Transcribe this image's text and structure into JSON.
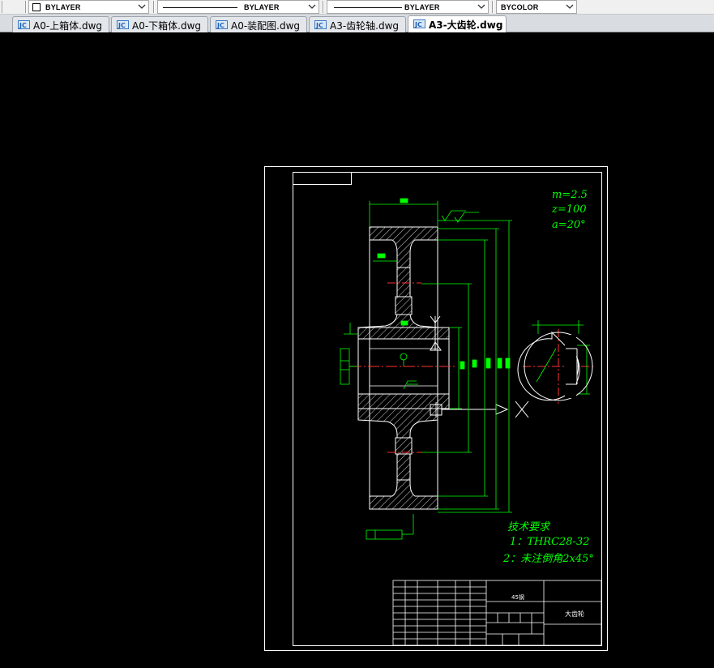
{
  "toolbar": {
    "color_dropdown": {
      "value": "BYLAYER",
      "icon": "color-swatch-icon"
    },
    "linetype_dropdown": {
      "value": "BYLAYER"
    },
    "lineweight_dropdown": {
      "value": "BYLAYER"
    },
    "plotstyle_dropdown": {
      "value": "BYCOLOR"
    }
  },
  "tabs": [
    {
      "label": "A0-上箱体.dwg",
      "active": false
    },
    {
      "label": "A0-下箱体.dwg",
      "active": false
    },
    {
      "label": "A0-装配图.dwg",
      "active": false
    },
    {
      "label": "A3-齿轮轴.dwg",
      "active": false
    },
    {
      "label": "A3-大齿轮.dwg",
      "active": true
    }
  ],
  "drawing": {
    "background": "#000000",
    "line_color": "#ffffff",
    "dimension_color": "#00ff00",
    "centerline_color": "#ff0000",
    "gear_params": [
      "m=2.5",
      "z=100",
      "a=20°"
    ],
    "tech_requirements": {
      "title": "技术要求",
      "items": [
        "1：THRC28-32",
        "2：未注倒角2x45°"
      ]
    },
    "title_block": {
      "material": "45钢",
      "part_name": "大齿轮"
    }
  }
}
